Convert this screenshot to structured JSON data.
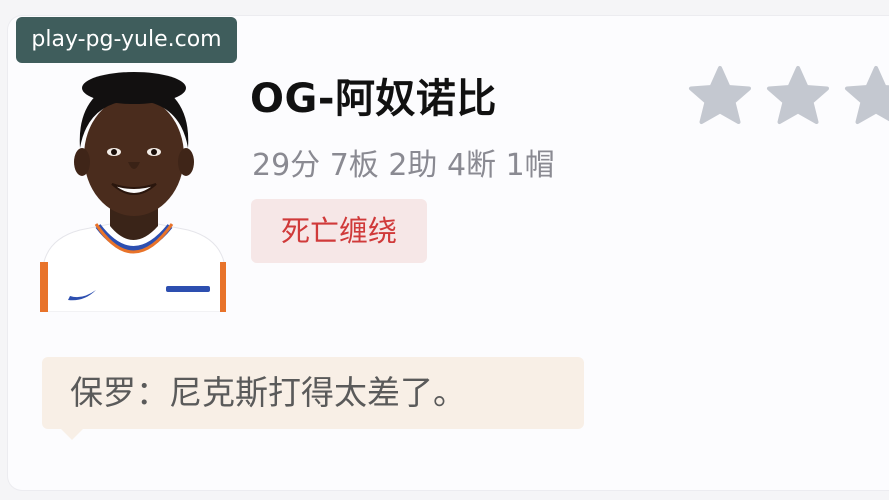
{
  "watermark": {
    "text": "play-pg-yule.com"
  },
  "player": {
    "name": "OG-阿奴诺比",
    "stats": "29分 7板 2助 4断 1帽",
    "tag": "死亡缠绕",
    "rating": {
      "visible_stars": 3,
      "star_color": "#c4c8d0"
    },
    "avatar": {
      "icon": "player-avatar",
      "jersey_color": "#ffffff",
      "trim_color": "#e8732a",
      "accent_color": "#2d4fb0"
    }
  },
  "comment": {
    "text": "保罗：尼克斯打得太差了。"
  },
  "colors": {
    "tag_bg": "#f6e7e7",
    "tag_text": "#d03a3a",
    "comment_bg": "#f8efe6",
    "watermark_bg": "#3f5d5c"
  }
}
